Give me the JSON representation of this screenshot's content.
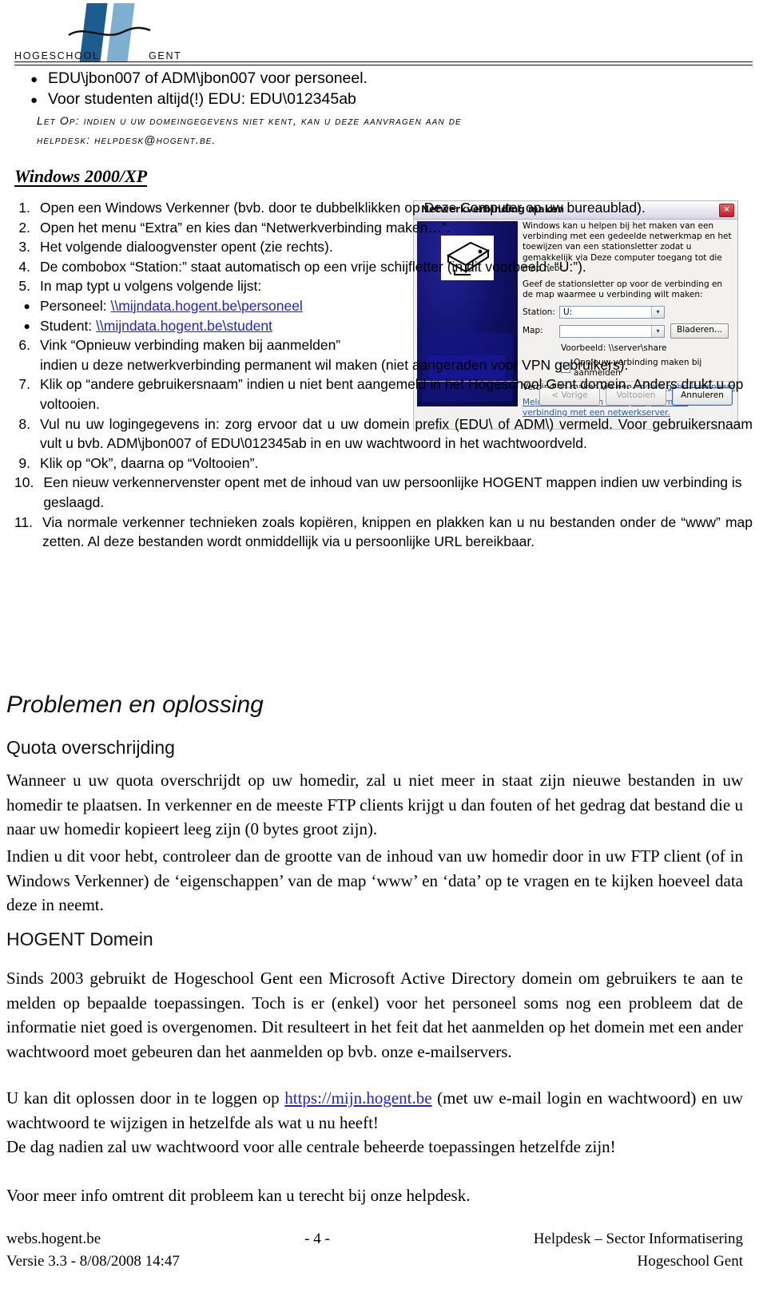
{
  "header": {
    "logo_word_left": "HOGESCHOOL",
    "logo_word_right": "GENT",
    "logo_colors": {
      "dark_blue": "#1d5c8e",
      "light_blue": "#7fafd0"
    }
  },
  "top_bullets": [
    "EDU\\jbon007 of ADM\\jbon007 voor personeel.",
    "Voor studenten altijd(!) EDU: EDU\\012345ab"
  ],
  "note": {
    "line1": "Let Op: indien u uw domeingegevens niet kent, kan u deze aanvragen aan de",
    "line2": "helpdesk: helpdesk@hogent.be."
  },
  "headings": {
    "windows": "Windows 2000/XP",
    "problemen": "Problemen en oplossing",
    "quota": "Quota overschrijding",
    "domein": "HOGENT Domein"
  },
  "procedure": [
    {
      "num": "1.",
      "text": "Open een Windows Verkenner (bvb. door te dubbelklikken op Deze Computer op uw bureaublad)."
    },
    {
      "num": "2.",
      "text": "Open het menu “Extra” en kies dan “Netwerkverbinding maken…”."
    },
    {
      "num": "3.",
      "text": "Het volgende dialoogvenster opent (zie rechts)."
    },
    {
      "num": "4.",
      "text": "De combobox “Station:” staat automatisch op een vrije schijfletter (in dit voorbeeld: “U:”)."
    },
    {
      "num": "5.",
      "text": "In map typt u volgens volgende lijst:"
    }
  ],
  "sub_bullets": [
    {
      "label": "Personeel: ",
      "link": "\\\\mijndata.hogent.be\\personeel"
    },
    {
      "label": "Student: ",
      "link": "\\\\mijndata.hogent.be\\student"
    }
  ],
  "procedure_cont": [
    {
      "num": "6.",
      "lead": "Vink “Opnieuw verbinding maken bij aanmelden”",
      "text": "indien u deze netwerkverbinding permanent wil maken (niet aangeraden voor VPN gebruikers)."
    },
    {
      "num": "7.",
      "text": "Klik op “andere gebruikersnaam” indien u niet bent aangemeld in het Hogeschool Gent domein. Anders drukt u op voltooien."
    },
    {
      "num": "8.",
      "text": "Vul nu uw logingegevens in: zorg ervoor dat u uw domein prefix (EDU\\ of ADM\\) vermeld. Voor gebruikersnaam vult u bvb. ADM\\jbon007 of EDU\\012345ab in en uw wachtwoord in het wachtwoordveld."
    },
    {
      "num": "9.",
      "text": "Klik op “Ok”, daarna op “Voltooien”."
    },
    {
      "num": "10.",
      "text": "Een nieuw verkennervenster opent met de inhoud van uw persoonlijke HOGENT mappen indien uw verbinding is geslaagd."
    },
    {
      "num": "11.",
      "text": "Via normale verkenner technieken zoals kopiëren, knippen en plakken kan u nu bestanden onder de “www” map zetten. Al deze bestanden wordt onmiddellijk via u persoonlijke URL bereikbaar."
    }
  ],
  "dialog": {
    "title": "Netwerkverbinding maken",
    "close_glyph": "×",
    "intro1": "Windows kan u helpen bij het maken van een verbinding met een gedeelde netwerkmap en het toewijzen van een stationsletter zodat u gemakkelijk via Deze computer toegang tot die map hebt.",
    "intro2": "Geef de stationsletter op voor de verbinding en de map waarmee u verbinding wilt maken:",
    "station_label": "Station:",
    "station_value": "U:",
    "map_label": "Map:",
    "map_value": "",
    "browse_button": "Bladeren...",
    "example": "Voorbeeld: \\\\server\\share",
    "checkbox_label": "Opnieuw verbinding maken bij aanmelden",
    "checkbox_checked": true,
    "check_glyph": "✓",
    "connect_prefix": "Verbinding maken via een ",
    "connect_link": "andere gebruikersnaam",
    "online_link": "Meld u aan voor on line opslag of maak verbinding met een netwerkserver.",
    "button_back": "< Vorige",
    "button_finish": "Voltooien",
    "button_cancel": "Annuleren",
    "dropdown_glyph": "▾"
  },
  "paragraphs": {
    "quota_1": "Wanneer u uw quota overschrijdt op uw homedir, zal u niet meer in staat zijn nieuwe bestanden in uw homedir te plaatsen. In verkenner en de meeste FTP clients krijgt u dan fouten of het gedrag dat bestand die u naar uw homedir kopieert leeg zijn (0 bytes groot zijn).",
    "quota_2": "Indien u dit voor hebt, controleer dan de grootte van de inhoud van uw homedir door in uw FTP client (of in Windows Verkenner) de ‘eigenschappen’ van de map ‘www’ en ‘data’ op te vragen en te kijken hoeveel data deze in neemt.",
    "domein_1": "Sinds 2003 gebruikt de Hogeschool Gent een Microsoft Active Directory domein om gebruikers te aan te melden op bepaalde toepassingen. Toch is er (enkel) voor het personeel soms nog een probleem dat de informatie niet goed is overgenomen. Dit resulteert in het feit dat het aanmelden op het domein met een ander wachtwoord moet gebeuren dan het aanmelden op bvb. onze e-mailservers.",
    "domein_2_pre": "U kan dit oplossen door in te loggen op ",
    "domein_2_link": "https://mijn.hogent.be",
    "domein_2_post": " (met uw e-mail login en wachtwoord) en uw wachtwoord te wijzigen in hetzelfde als wat u nu heeft!",
    "domein_3": "De dag nadien zal uw wachtwoord voor alle centrale beheerde toepassingen hetzelfde zijn!",
    "domein_4": "Voor meer info omtrent dit probleem kan u terecht bij onze helpdesk."
  },
  "footer": {
    "left_top": "webs.hogent.be",
    "center": "- 4 -",
    "right_top": "Helpdesk – Sector Informatisering",
    "left_bottom": "Versie 3.3 - 8/08/2008 14:47",
    "right_bottom": "Hogeschool Gent"
  }
}
